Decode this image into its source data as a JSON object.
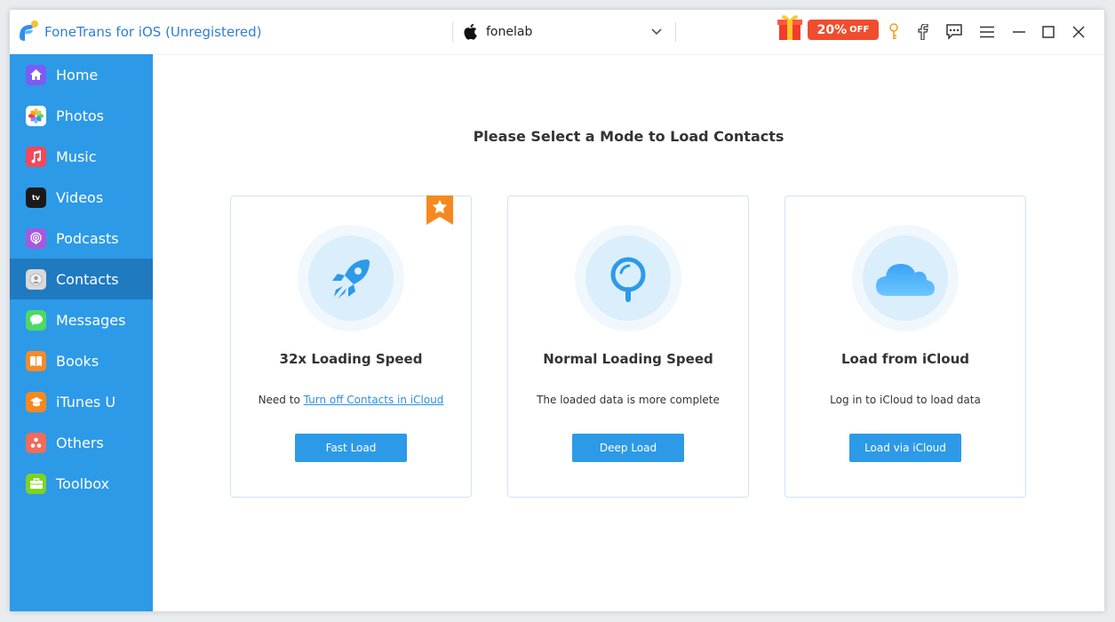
{
  "app": {
    "title": "FoneTrans for iOS (Unregistered)"
  },
  "device": {
    "name": "fonelab"
  },
  "promo": {
    "discount": "20%",
    "suffix": "OFF"
  },
  "titlebar_icons": [
    "gift-icon",
    "key-icon",
    "facebook-icon",
    "feedback-icon",
    "menu-icon",
    "minimize-icon",
    "maximize-icon",
    "close-icon"
  ],
  "sidebar": {
    "active": "Contacts",
    "items": [
      {
        "label": "Home",
        "icon": "home-icon",
        "color": "#7b5cf5"
      },
      {
        "label": "Photos",
        "icon": "photos-icon",
        "color": "#ffffff"
      },
      {
        "label": "Music",
        "icon": "music-icon",
        "color": "#f5485b"
      },
      {
        "label": "Videos",
        "icon": "videos-icon",
        "color": "#1a1a1a"
      },
      {
        "label": "Podcasts",
        "icon": "podcasts-icon",
        "color": "#a45ae0"
      },
      {
        "label": "Contacts",
        "icon": "contacts-icon",
        "color": "#d8d8d8"
      },
      {
        "label": "Messages",
        "icon": "messages-icon",
        "color": "#4cd964"
      },
      {
        "label": "Books",
        "icon": "books-icon",
        "color": "#f58a2a"
      },
      {
        "label": "iTunes U",
        "icon": "itunes-u-icon",
        "color": "#f5891f"
      },
      {
        "label": "Others",
        "icon": "others-icon",
        "color": "#f26b5b"
      },
      {
        "label": "Toolbox",
        "icon": "toolbox-icon",
        "color": "#7ed321"
      }
    ]
  },
  "main": {
    "title": "Please Select a Mode to Load Contacts",
    "cards": [
      {
        "icon": "rocket-icon",
        "badge_icon": "star-ribbon-icon",
        "title": "32x Loading Speed",
        "desc_prefix": "Need to ",
        "desc_link": "Turn off Contacts in iCloud",
        "button": "Fast Load"
      },
      {
        "icon": "magnifier-icon",
        "title": "Normal Loading Speed",
        "desc": "The loaded data is more complete",
        "button": "Deep Load"
      },
      {
        "icon": "icloud-icon",
        "title": "Load from iCloud",
        "desc": "Log in to iCloud to load data",
        "button": "Load via iCloud"
      }
    ]
  },
  "colors": {
    "sidebar_bg": "#2d9ae8",
    "sidebar_active": "#1f7ac0",
    "accent": "#2d9ae8",
    "promo": "#f04d2e",
    "ribbon": "#f5891f"
  }
}
